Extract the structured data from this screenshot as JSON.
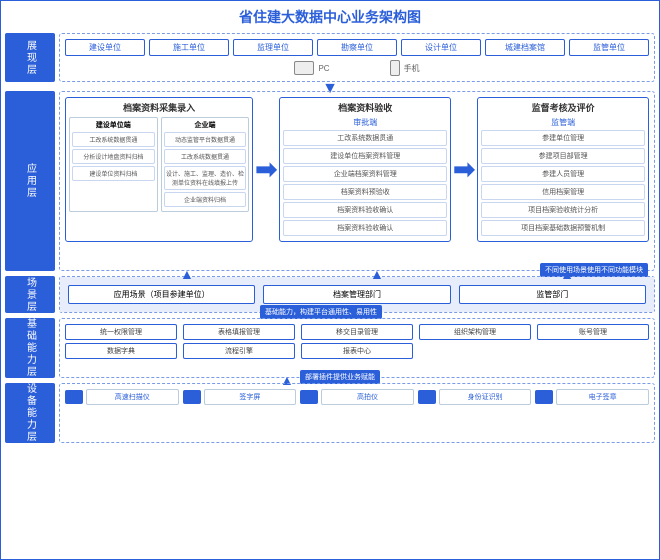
{
  "title": "省住建大数据中心业务架构图",
  "layers": {
    "l1": {
      "label": "展现层",
      "units": [
        "建设单位",
        "施工单位",
        "监理单位",
        "勘察单位",
        "设计单位",
        "城建档案馆",
        "监管单位"
      ],
      "devices": [
        "PC",
        "手机"
      ]
    },
    "l2": {
      "label": "应用层",
      "col1": {
        "title": "档案资料采集录入",
        "subs": [
          {
            "head": "建设单位端",
            "items": [
              "工改系统数据贯通",
              "分析设计地盘资料归档",
              "建设单位资料归档"
            ]
          },
          {
            "head": "企业端",
            "items": [
              "动态监管平台数据贯通",
              "工改系统数据贯通",
              "设计、施工、监理、造价、检测单位资料在线填报上传",
              "企业端资料归档"
            ]
          }
        ]
      },
      "col2": {
        "title": "档案资料验收",
        "sub": "审批端",
        "items": [
          "工改系统数据贯通",
          "建设单位档案资料管理",
          "企业端档案资料管理",
          "档案资料预验收",
          "档案资料验收确认",
          "档案资料验收确认"
        ]
      },
      "col3": {
        "title": "监督考核及评价",
        "sub": "监管端",
        "items": [
          "参建单位管理",
          "参建项目部管理",
          "参建人员管理",
          "信用档案管理",
          "项目档案验收统计分析",
          "项目档案基础数据预警机制"
        ]
      },
      "note": "不同使用场景使用不同功能模块"
    },
    "l3": {
      "label": "场景层",
      "boxes": [
        "应用场景（项目参建单位）",
        "档案管理部门",
        "监管部门"
      ],
      "note": "基础能力，构建平台通用性、易用性"
    },
    "l4": {
      "label": "基础能力层",
      "row1": [
        "统一权限管理",
        "表格填报管理",
        "移交目录管理",
        "组织架构管理",
        "账号管理"
      ],
      "row2": [
        "数据字典",
        "流程引擎",
        "报表中心",
        "",
        ""
      ],
      "note": "部署插件提供业务赋能"
    },
    "l5": {
      "label": "设备能力层",
      "equips": [
        "高速扫描仪",
        "签字屏",
        "高拍仪",
        "身份证识别",
        "电子签章"
      ]
    }
  }
}
